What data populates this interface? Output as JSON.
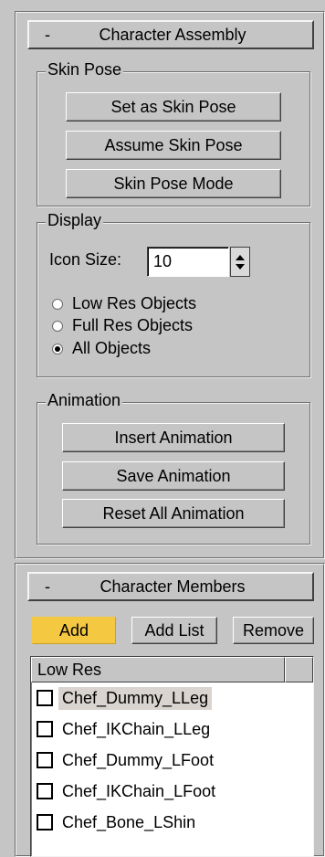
{
  "character_assembly": {
    "collapse_symbol": "-",
    "title": "Character Assembly",
    "skin_pose": {
      "group_label": "Skin Pose",
      "set_as_skin_pose": "Set as Skin Pose",
      "assume_skin_pose": "Assume Skin Pose",
      "skin_pose_mode": "Skin Pose Mode"
    },
    "display": {
      "group_label": "Display",
      "icon_size_label": "Icon Size:",
      "icon_size_value": "10",
      "options": [
        {
          "label": "Low Res Objects",
          "checked": false
        },
        {
          "label": "Full Res Objects",
          "checked": false
        },
        {
          "label": "All Objects",
          "checked": true
        }
      ]
    },
    "animation": {
      "group_label": "Animation",
      "insert": "Insert Animation",
      "save": "Save Animation",
      "reset": "Reset All Animation"
    }
  },
  "character_members": {
    "collapse_symbol": "-",
    "title": "Character Members",
    "add": "Add",
    "add_list": "Add List",
    "remove": "Remove",
    "list": {
      "column_header": "Low Res",
      "items": [
        {
          "label": "Chef_Dummy_LLeg",
          "selected": true
        },
        {
          "label": "Chef_IKChain_LLeg",
          "selected": false
        },
        {
          "label": "Chef_Dummy_LFoot",
          "selected": false
        },
        {
          "label": "Chef_IKChain_LFoot",
          "selected": false
        },
        {
          "label": "Chef_Bone_LShin",
          "selected": false
        }
      ]
    }
  },
  "colors": {
    "panel_bg": "#c5c5c5",
    "active_button": "#f5c842",
    "selected_row": "#d9d4cf"
  }
}
